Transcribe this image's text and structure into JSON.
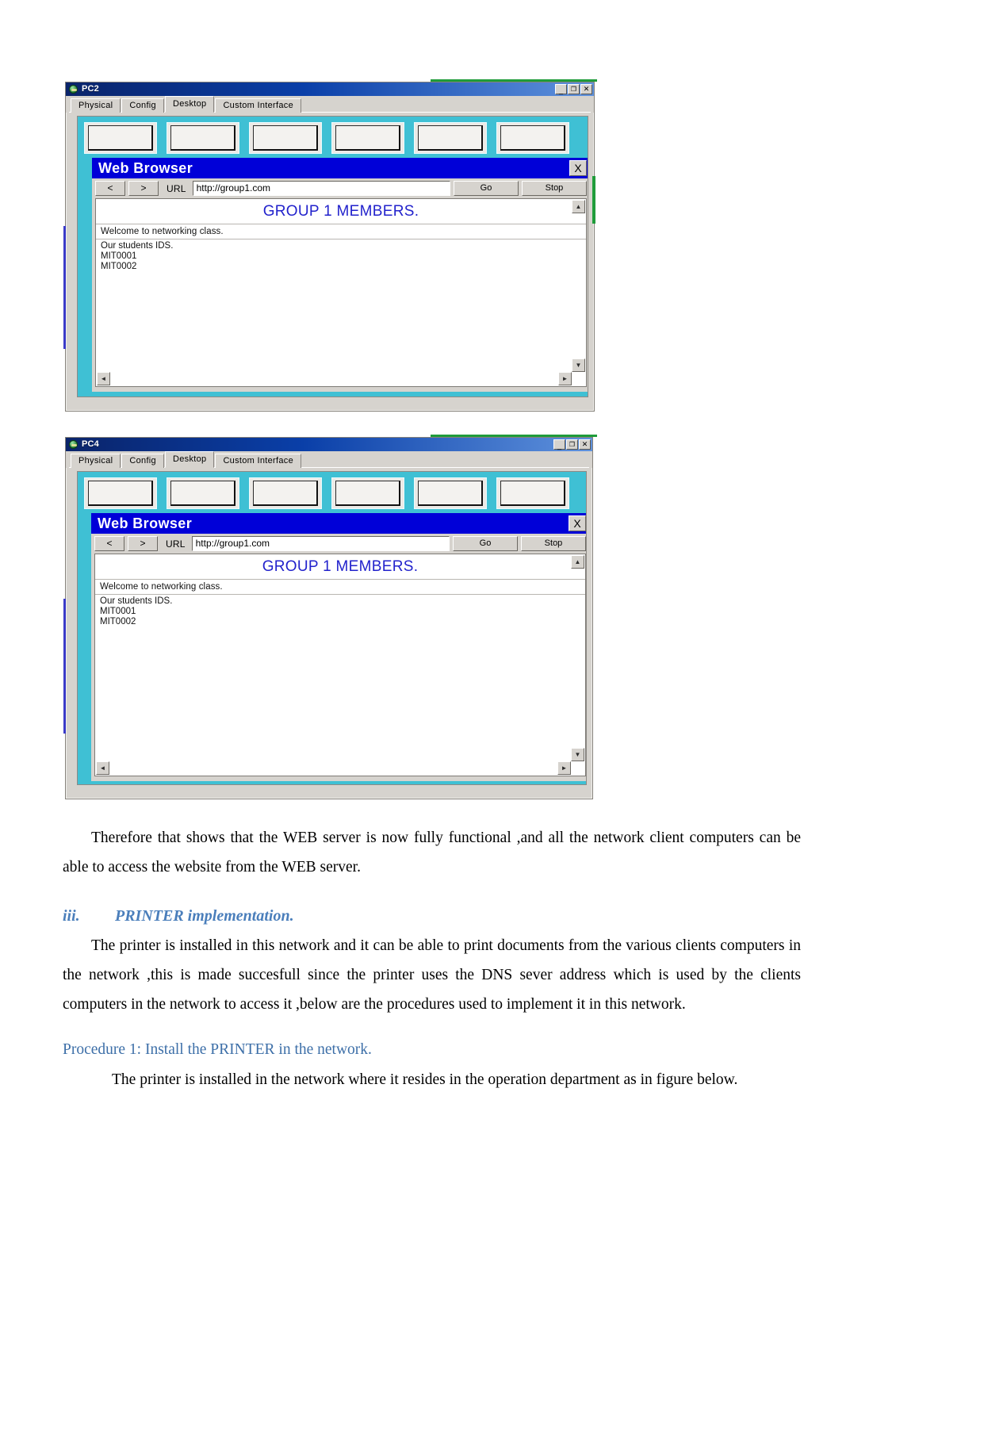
{
  "document": {
    "paragraphs": {
      "p1": "Therefore that shows that the WEB server is now fully functional ,and all the network client computers can be able to access the website from the WEB server.",
      "heading_numeral": "iii.",
      "heading_text": "PRINTER implementation.",
      "p2": "The printer is installed in this network and it can be able to print documents from the various clients computers in the network ,this is made succesfull since the printer uses the DNS sever address which is used by the clients computers  in the network to access it ,below are the procedures used to implement it in this network.",
      "procedure_1": "Procedure 1: Install the PRINTER in the network.",
      "p3": "The printer is installed in the network where it resides in the operation department as in figure below."
    },
    "colors": {
      "heading": "#4a7ebb",
      "procedure": "#3d6fa8",
      "body": "#000000"
    }
  },
  "screenshots": [
    {
      "window_title": "PC2",
      "window_buttons": {
        "minimize": "_",
        "maximize": "❐",
        "close": "✕"
      },
      "tabs": [
        {
          "label": "Physical",
          "active": false
        },
        {
          "label": "Config",
          "active": false
        },
        {
          "label": "Desktop",
          "active": true
        },
        {
          "label": "Custom Interface",
          "active": false
        }
      ],
      "browser": {
        "title": "Web Browser",
        "close_label": "X",
        "back_label": "<",
        "forward_label": ">",
        "url_label": "URL",
        "url_value": "http://group1.com",
        "go_label": "Go",
        "stop_label": "Stop",
        "page": {
          "heading": "GROUP 1 MEMBERS.",
          "welcome": "Welcome to networking class.",
          "ids_label": "Our students IDS.",
          "ids": [
            "MIT0001",
            "MIT0002"
          ]
        },
        "scrollbar": {
          "up": "▲",
          "down": "▼",
          "left": "◄",
          "right": "►"
        }
      }
    },
    {
      "window_title": "PC4",
      "window_buttons": {
        "minimize": "_",
        "maximize": "❐",
        "close": "✕"
      },
      "tabs": [
        {
          "label": "Physical",
          "active": false
        },
        {
          "label": "Config",
          "active": false
        },
        {
          "label": "Desktop",
          "active": true
        },
        {
          "label": "Custom Interface",
          "active": false
        }
      ],
      "browser": {
        "title": "Web Browser",
        "close_label": "X",
        "back_label": "<",
        "forward_label": ">",
        "url_label": "URL",
        "url_value": "http://group1.com",
        "go_label": "Go",
        "stop_label": "Stop",
        "page": {
          "heading": "GROUP 1 MEMBERS.",
          "welcome": "Welcome to networking class.",
          "ids_label": "Our students IDS.",
          "ids": [
            "MIT0001",
            "MIT0002"
          ]
        },
        "scrollbar": {
          "up": "▲",
          "down": "▼",
          "left": "◄",
          "right": "►"
        }
      }
    }
  ]
}
